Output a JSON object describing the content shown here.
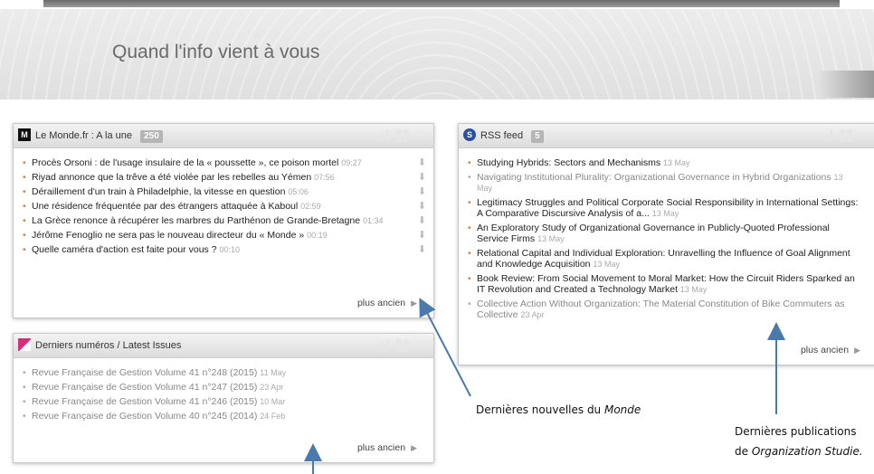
{
  "header": {
    "title": "Quand l'info vient à vous"
  },
  "widgets": {
    "lemonde": {
      "title": "Le Monde.fr : A la une",
      "count": "250",
      "more": "plus ancien",
      "items": [
        {
          "text": "Procès Orsoni : de l'usage insulaire de la « poussette », ce poison mortel",
          "date": "09:27"
        },
        {
          "text": "Riyad annonce que la trêve a été violée par les rebelles au Yémen",
          "date": "07:56"
        },
        {
          "text": "Déraillement d'un train à Philadelphie, la vitesse en question",
          "date": "05:06"
        },
        {
          "text": "Une résidence fréquentée par des étrangers attaquée à Kaboul",
          "date": "02:59"
        },
        {
          "text": "La Grèce renonce à récupérer les marbres du Parthénon de Grande-Bretagne",
          "date": "01:34"
        },
        {
          "text": "Jérôme Fenoglio ne sera pas le nouveau directeur du « Monde »",
          "date": "00:19"
        },
        {
          "text": "Quelle caméra d'action est faite pour vous ?",
          "date": "00:10"
        }
      ]
    },
    "rss": {
      "title": "RSS feed",
      "count": "5",
      "more": "plus ancien",
      "items": [
        {
          "text": "Studying Hybrids: Sectors and Mechanisms",
          "date": "13 May",
          "read": false
        },
        {
          "text": "Navigating Institutional Plurality: Organizational Governance in Hybrid Organizations",
          "date": "13 May",
          "read": true
        },
        {
          "text": "Legitimacy Struggles and Political Corporate Social Responsibility in International Settings: A Comparative Discursive Analysis of a...",
          "date": "13 May",
          "read": false
        },
        {
          "text": "An Exploratory Study of Organizational Governance in Publicly-Quoted Professional Service Firms",
          "date": "13 May",
          "read": false
        },
        {
          "text": "Relational Capital and Individual Exploration: Unravelling the Influence of Goal Alignment and Knowledge Acquisition",
          "date": "13 May",
          "read": false
        },
        {
          "text": "Book Review: From Social Movement to Moral Market: How the Circuit Riders Sparked an IT Revolution and Created a Technology Market",
          "date": "13 May",
          "read": false
        },
        {
          "text": "Collective Action Without Organization: The Material Constitution of Bike Commuters as Collective",
          "date": "23 Apr",
          "read": true
        }
      ]
    },
    "issues": {
      "title": "Derniers numéros / Latest Issues",
      "more": "plus ancien",
      "items": [
        {
          "text": "Revue Française de Gestion Volume 41 n°248 (2015)",
          "date": "11 May"
        },
        {
          "text": "Revue Française de Gestion Volume 41 n°247 (2015)",
          "date": "23 Apr"
        },
        {
          "text": "Revue Française de Gestion Volume 41 n°246 (2015)",
          "date": "10 Mar"
        },
        {
          "text": "Revue Française de Gestion Volume 40 n°245 (2014)",
          "date": "24 Feb"
        }
      ]
    }
  },
  "annotations": {
    "monde": {
      "prefix": "Dernières nouvelles du ",
      "em": "Monde"
    },
    "orgstudies": {
      "line1": "Dernières publications",
      "prefix": "de ",
      "em": "Organization Studie."
    }
  },
  "colors": {
    "arrow": "#4a79ad",
    "bullet": "#c48a3e",
    "accent_pink": "#d4307a",
    "rss_blue": "#2b4f9e"
  }
}
